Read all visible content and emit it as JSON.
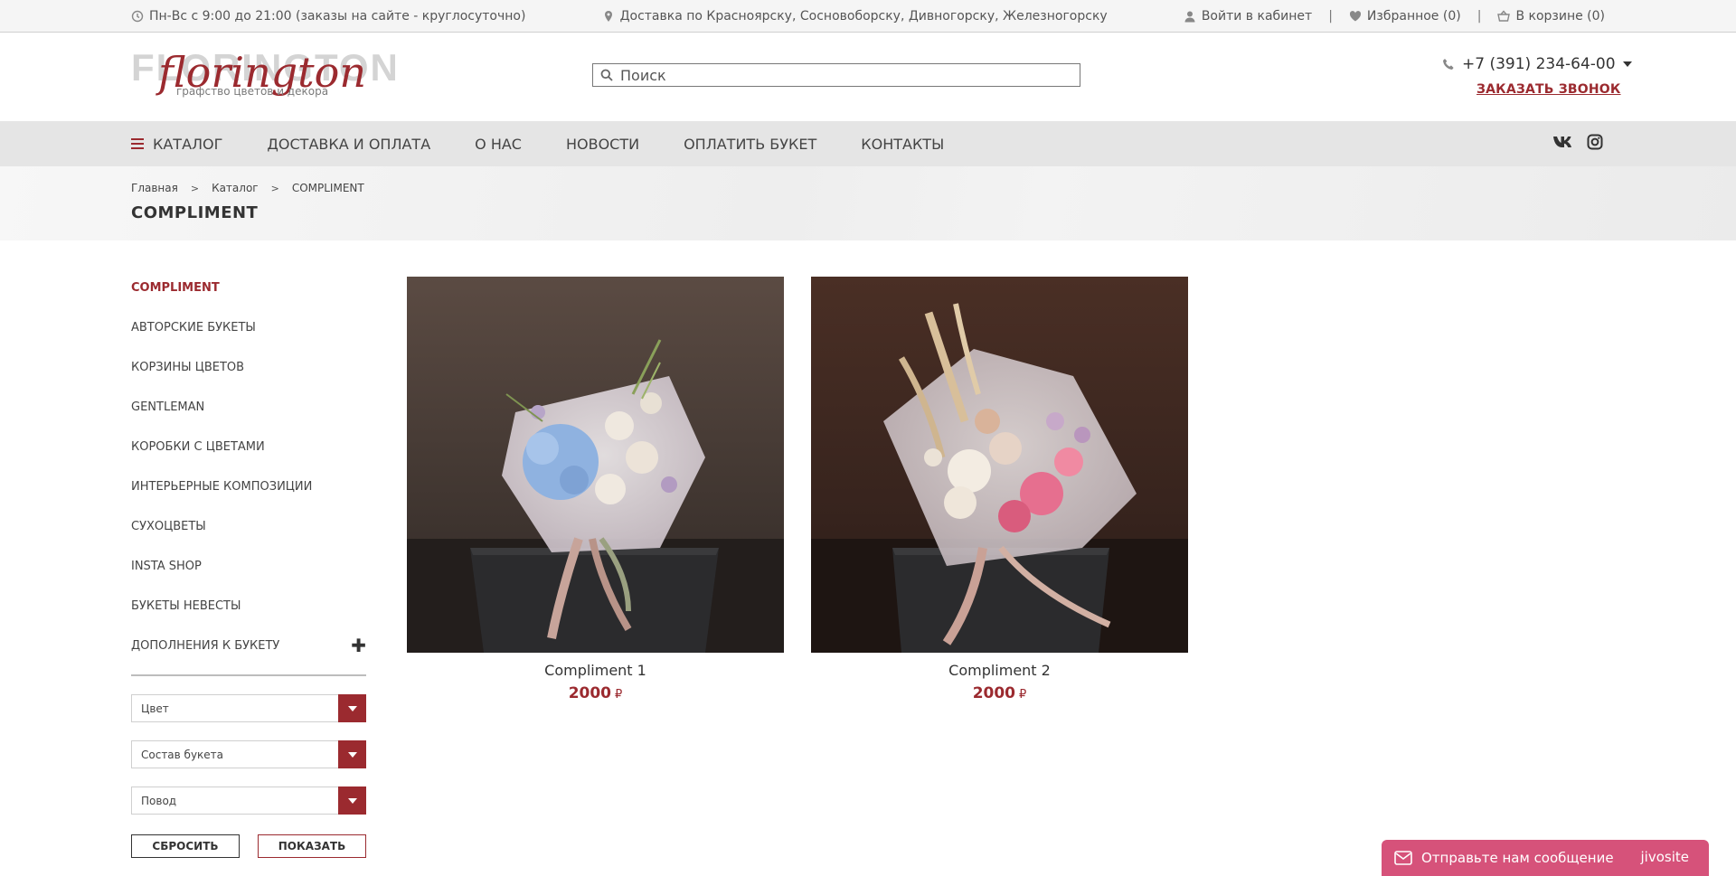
{
  "topbar": {
    "hours": "Пн-Вс с 9:00 до 21:00 (заказы на сайте - круглосуточно)",
    "delivery": "Доставка по Красноярску, Сосновоборску, Дивногорску, Железногорску",
    "login": "Войти в кабинет",
    "favorites": "Избранное (0)",
    "cart": "В корзине (0)",
    "separator": "|"
  },
  "header": {
    "logo_ghost": "FLORINGTON",
    "logo_script": "florington",
    "logo_tagline": "графство цветов и декора",
    "search_placeholder": "Поиск",
    "phone": "+7 (391) 234-64-00",
    "callback": "ЗАКАЗАТЬ ЗВОНОК"
  },
  "nav": {
    "items": [
      "КАТАЛОГ",
      "ДОСТАВКА И ОПЛАТА",
      "О НАС",
      "НОВОСТИ",
      "ОПЛАТИТЬ БУКЕТ",
      "КОНТАКТЫ"
    ]
  },
  "breadcrumb": {
    "items": [
      "Главная",
      "Каталог",
      "COMPLIMENT"
    ],
    "arrow": ">"
  },
  "page_title": "COMPLIMENT",
  "sidebar": {
    "categories": [
      "COMPLIMENT",
      "АВТОРСКИЕ БУКЕТЫ",
      "КОРЗИНЫ ЦВЕТОВ",
      "GENTLEMAN",
      "КОРОБКИ С ЦВЕТАМИ",
      "ИНТЕРЬЕРНЫЕ КОМПОЗИЦИИ",
      "СУХОЦВЕТЫ",
      "INSTA SHOP",
      "БУКЕТЫ НЕВЕСТЫ",
      "ДОПОЛНЕНИЯ К БУКЕТУ"
    ],
    "expand_symbol": "✚",
    "filters": [
      "Цвет",
      "Состав букета",
      "Повод"
    ],
    "reset_label": "СБРОСИТЬ",
    "show_label": "ПОКАЗАТЬ"
  },
  "products": [
    {
      "name": "Compliment 1",
      "price": "2000",
      "currency": "₽"
    },
    {
      "name": "Compliment 2",
      "price": "2000",
      "currency": "₽"
    }
  ],
  "chat": {
    "label": "Отправьте нам сообщение",
    "brand": "jivosite"
  },
  "colors": {
    "accent": "#9b2a2f",
    "chat": "#d6527a"
  }
}
